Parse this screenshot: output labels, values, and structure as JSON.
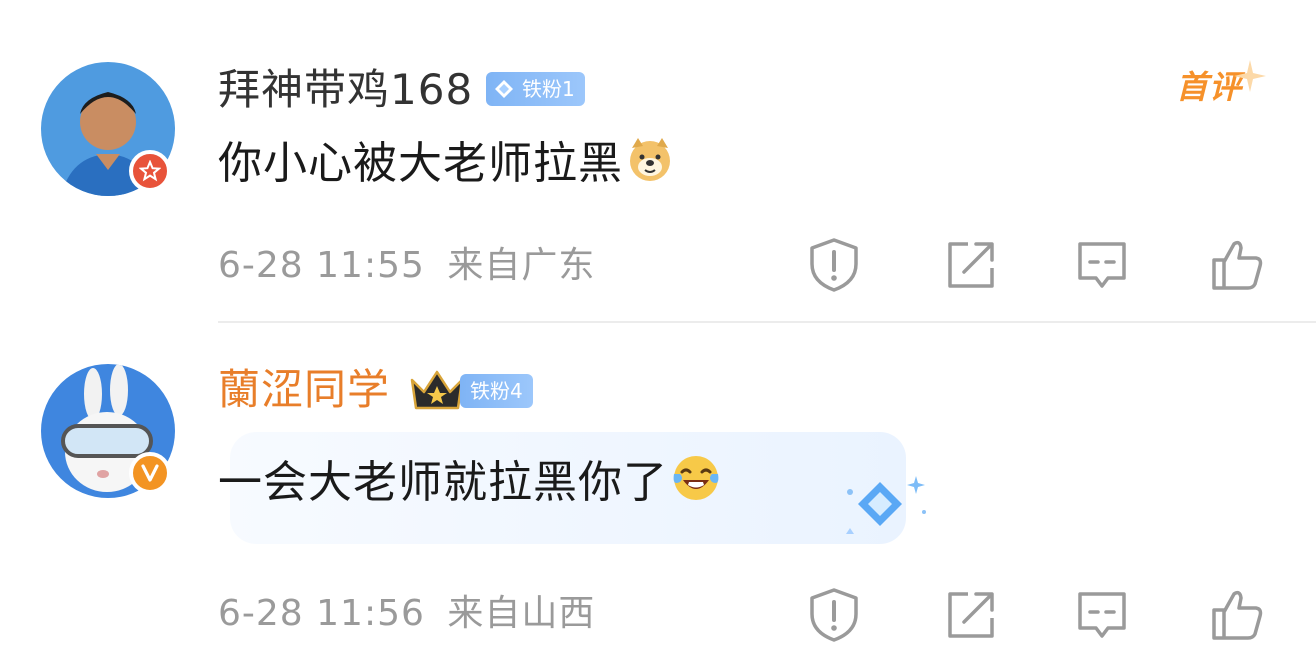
{
  "comments": [
    {
      "username": "拜神带鸡168",
      "fan_badge": "铁粉1",
      "text": "你小心被大老师拉黑",
      "emoji": "doge-emoji",
      "time": "6-28 11:55",
      "location": "来自广东",
      "tag": "首评",
      "username_color": "#333333",
      "verified_badge_color": "#e8533a"
    },
    {
      "username": "蘭涩同学",
      "fan_badge": "铁粉4",
      "text": "一会大老师就拉黑你了",
      "emoji": "laugh-cry-emoji",
      "time": "6-28 11:56",
      "location": "来自山西",
      "username_color": "#e87e2a",
      "verified_badge_color": "#f39423"
    }
  ],
  "action_icons": [
    "report-icon",
    "repost-icon",
    "reply-icon",
    "like-icon"
  ],
  "colors": {
    "meta": "#9a9a9a",
    "fan_badge": "#8cbcf7",
    "first_tag": "#f6912a"
  }
}
